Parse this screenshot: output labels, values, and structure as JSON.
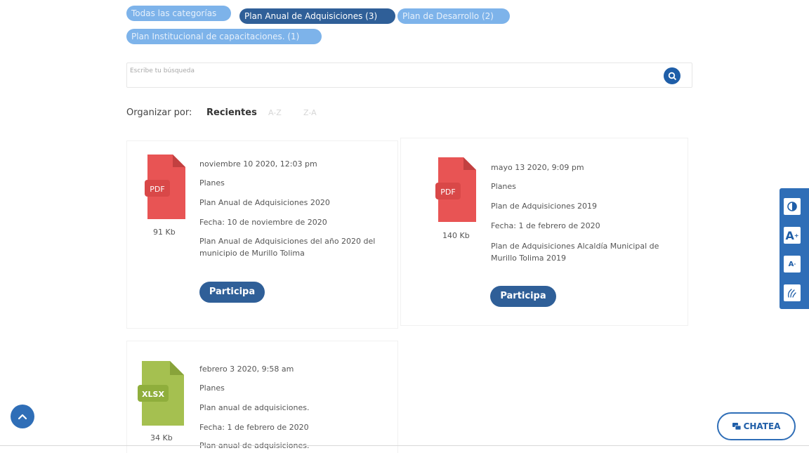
{
  "categories": [
    {
      "label": "Todas las categorías",
      "active": false
    },
    {
      "label": "Plan Anual de Adquisiciones (3)",
      "active": true
    },
    {
      "label": "Plan de Desarrollo (2)",
      "active": false
    },
    {
      "label": "Plan Institucional de capacitaciones. (1)",
      "active": false
    }
  ],
  "search": {
    "placeholder": "Escribe tu búsqueda",
    "icon": "search-icon"
  },
  "sort": {
    "label": "Organizar por:",
    "active": "Recientes",
    "options": [
      "A-Z",
      "Z-A"
    ]
  },
  "documents": [
    {
      "file_type": "PDF",
      "file_color": "#e85454",
      "size": "91 Kb",
      "date": "noviembre 10 2020, 12:03 pm",
      "category": "Planes",
      "title": "Plan Anual de Adquisiciones 2020",
      "fecha": "Fecha: 10 de noviembre de 2020",
      "description_line1": "Plan Anual de Adquisiciones del año 2020 del",
      "description_line2": "municipio de Murillo Tolima",
      "button": "Participa"
    },
    {
      "file_type": "PDF",
      "file_color": "#e85454",
      "size": "140 Kb",
      "date": "mayo 13 2020, 9:09 pm",
      "category": "Planes",
      "title": "Plan de Adquisiciones 2019",
      "fecha": "Fecha: 1 de febrero de 2020",
      "description_line1": "Plan de Adquisiciones Alcaldía Municipal de",
      "description_line2": "Murillo Tolima 2019",
      "button": "Participa"
    },
    {
      "file_type": "XLSX",
      "file_color": "#a5c050",
      "size": "34 Kb",
      "date": "febrero 3 2020, 9:58 am",
      "category": "Planes",
      "title": "Plan anual de adquisiciones.",
      "fecha": "Fecha: 1 de febrero de 2020",
      "description_line1": "Plan anual de adquisiciones."
    }
  ],
  "accessibility": {
    "contrast_icon": "contrast-icon",
    "increase_label": "A",
    "increase_sup": "+",
    "decrease_label": "A",
    "decrease_sup": "-",
    "sign_language_icon": "sign-language-icon"
  },
  "scroll_top_icon": "chevron-up-icon",
  "chat": {
    "label": "CHATEA",
    "icon": "chat-icon"
  }
}
